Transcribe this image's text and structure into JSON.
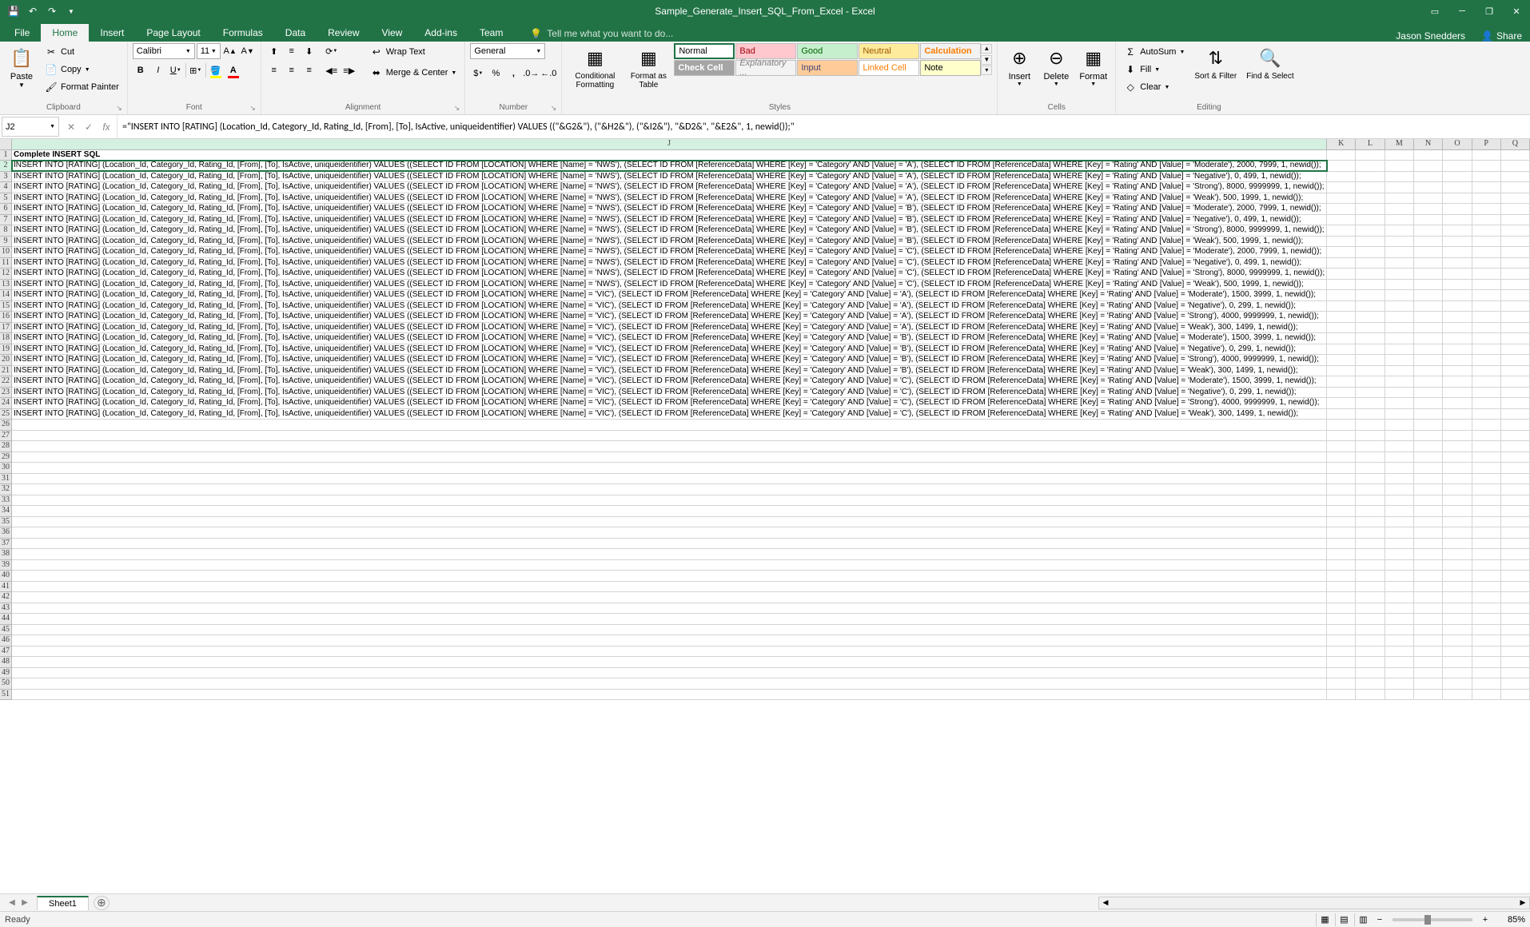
{
  "titlebar": {
    "title": "Sample_Generate_Insert_SQL_From_Excel - Excel"
  },
  "ribbon": {
    "tabs": [
      "File",
      "Home",
      "Insert",
      "Page Layout",
      "Formulas",
      "Data",
      "Review",
      "View",
      "Add-ins",
      "Team"
    ],
    "active_tab": "Home",
    "tellme_placeholder": "Tell me what you want to do...",
    "user": "Jason Snedders",
    "share": "Share"
  },
  "clipboard": {
    "paste": "Paste",
    "cut": "Cut",
    "copy": "Copy",
    "format_painter": "Format Painter",
    "group_label": "Clipboard"
  },
  "font": {
    "name": "Calibri",
    "size": "11",
    "group_label": "Font"
  },
  "alignment": {
    "wrap": "Wrap Text",
    "merge": "Merge & Center",
    "group_label": "Alignment"
  },
  "number": {
    "format": "General",
    "group_label": "Number"
  },
  "styles_group": {
    "conditional": "Conditional Formatting",
    "format_table": "Format as Table",
    "cells": {
      "normal": "Normal",
      "bad": "Bad",
      "good": "Good",
      "neutral": "Neutral",
      "calculation": "Calculation",
      "check": "Check Cell",
      "explanatory": "Explanatory ...",
      "input": "Input",
      "linked": "Linked Cell",
      "note": "Note"
    },
    "group_label": "Styles"
  },
  "cells_group": {
    "insert": "Insert",
    "delete": "Delete",
    "format": "Format",
    "group_label": "Cells"
  },
  "editing": {
    "autosum": "AutoSum",
    "fill": "Fill",
    "clear": "Clear",
    "sort": "Sort & Filter",
    "find": "Find & Select",
    "group_label": "Editing"
  },
  "formula_bar": {
    "cell_ref": "J2",
    "formula": "=\"INSERT INTO [RATING] (Location_Id, Category_Id, Rating_Id, [From], [To], IsActive, uniqueidentifier) VALUES ((\"&G2&\"), (\"&H2&\"), (\"&I2&\"), \"&D2&\", \"&E2&\", 1, newid());\""
  },
  "grid": {
    "columns": [
      "J",
      "K",
      "L",
      "M",
      "N",
      "O",
      "P",
      "Q"
    ],
    "header_row": "Complete INSERT SQL",
    "rows": [
      "INSERT INTO [RATING] (Location_Id, Category_Id, Rating_Id, [From], [To], IsActive, uniqueidentifier) VALUES ((SELECT ID FROM [LOCATION] WHERE [Name] = 'NWS'), (SELECT ID FROM [ReferenceData] WHERE [Key] = 'Category' AND [Value] = 'A'), (SELECT ID FROM [ReferenceData] WHERE [Key] = 'Rating' AND [Value] = 'Moderate'), 2000, 7999, 1, newid());",
      "INSERT INTO [RATING] (Location_Id, Category_Id, Rating_Id, [From], [To], IsActive, uniqueidentifier) VALUES ((SELECT ID FROM [LOCATION] WHERE [Name] = 'NWS'), (SELECT ID FROM [ReferenceData] WHERE [Key] = 'Category' AND [Value] = 'A'), (SELECT ID FROM [ReferenceData] WHERE [Key] = 'Rating' AND [Value] = 'Negative'), 0, 499, 1, newid());",
      "INSERT INTO [RATING] (Location_Id, Category_Id, Rating_Id, [From], [To], IsActive, uniqueidentifier) VALUES ((SELECT ID FROM [LOCATION] WHERE [Name] = 'NWS'), (SELECT ID FROM [ReferenceData] WHERE [Key] = 'Category' AND [Value] = 'A'), (SELECT ID FROM [ReferenceData] WHERE [Key] = 'Rating' AND [Value] = 'Strong'), 8000, 9999999, 1, newid());",
      "INSERT INTO [RATING] (Location_Id, Category_Id, Rating_Id, [From], [To], IsActive, uniqueidentifier) VALUES ((SELECT ID FROM [LOCATION] WHERE [Name] = 'NWS'), (SELECT ID FROM [ReferenceData] WHERE [Key] = 'Category' AND [Value] = 'A'), (SELECT ID FROM [ReferenceData] WHERE [Key] = 'Rating' AND [Value] = 'Weak'), 500, 1999, 1, newid());",
      "INSERT INTO [RATING] (Location_Id, Category_Id, Rating_Id, [From], [To], IsActive, uniqueidentifier) VALUES ((SELECT ID FROM [LOCATION] WHERE [Name] = 'NWS'), (SELECT ID FROM [ReferenceData] WHERE [Key] = 'Category' AND [Value] = 'B'), (SELECT ID FROM [ReferenceData] WHERE [Key] = 'Rating' AND [Value] = 'Moderate'), 2000, 7999, 1, newid());",
      "INSERT INTO [RATING] (Location_Id, Category_Id, Rating_Id, [From], [To], IsActive, uniqueidentifier) VALUES ((SELECT ID FROM [LOCATION] WHERE [Name] = 'NWS'), (SELECT ID FROM [ReferenceData] WHERE [Key] = 'Category' AND [Value] = 'B'), (SELECT ID FROM [ReferenceData] WHERE [Key] = 'Rating' AND [Value] = 'Negative'), 0, 499, 1, newid());",
      "INSERT INTO [RATING] (Location_Id, Category_Id, Rating_Id, [From], [To], IsActive, uniqueidentifier) VALUES ((SELECT ID FROM [LOCATION] WHERE [Name] = 'NWS'), (SELECT ID FROM [ReferenceData] WHERE [Key] = 'Category' AND [Value] = 'B'), (SELECT ID FROM [ReferenceData] WHERE [Key] = 'Rating' AND [Value] = 'Strong'), 8000, 9999999, 1, newid());",
      "INSERT INTO [RATING] (Location_Id, Category_Id, Rating_Id, [From], [To], IsActive, uniqueidentifier) VALUES ((SELECT ID FROM [LOCATION] WHERE [Name] = 'NWS'), (SELECT ID FROM [ReferenceData] WHERE [Key] = 'Category' AND [Value] = 'B'), (SELECT ID FROM [ReferenceData] WHERE [Key] = 'Rating' AND [Value] = 'Weak'), 500, 1999, 1, newid());",
      "INSERT INTO [RATING] (Location_Id, Category_Id, Rating_Id, [From], [To], IsActive, uniqueidentifier) VALUES ((SELECT ID FROM [LOCATION] WHERE [Name] = 'NWS'), (SELECT ID FROM [ReferenceData] WHERE [Key] = 'Category' AND [Value] = 'C'), (SELECT ID FROM [ReferenceData] WHERE [Key] = 'Rating' AND [Value] = 'Moderate'), 2000, 7999, 1, newid());",
      "INSERT INTO [RATING] (Location_Id, Category_Id, Rating_Id, [From], [To], IsActive, uniqueidentifier) VALUES ((SELECT ID FROM [LOCATION] WHERE [Name] = 'NWS'), (SELECT ID FROM [ReferenceData] WHERE [Key] = 'Category' AND [Value] = 'C'), (SELECT ID FROM [ReferenceData] WHERE [Key] = 'Rating' AND [Value] = 'Negative'), 0, 499, 1, newid());",
      "INSERT INTO [RATING] (Location_Id, Category_Id, Rating_Id, [From], [To], IsActive, uniqueidentifier) VALUES ((SELECT ID FROM [LOCATION] WHERE [Name] = 'NWS'), (SELECT ID FROM [ReferenceData] WHERE [Key] = 'Category' AND [Value] = 'C'), (SELECT ID FROM [ReferenceData] WHERE [Key] = 'Rating' AND [Value] = 'Strong'), 8000, 9999999, 1, newid());",
      "INSERT INTO [RATING] (Location_Id, Category_Id, Rating_Id, [From], [To], IsActive, uniqueidentifier) VALUES ((SELECT ID FROM [LOCATION] WHERE [Name] = 'NWS'), (SELECT ID FROM [ReferenceData] WHERE [Key] = 'Category' AND [Value] = 'C'), (SELECT ID FROM [ReferenceData] WHERE [Key] = 'Rating' AND [Value] = 'Weak'), 500, 1999, 1, newid());",
      "INSERT INTO [RATING] (Location_Id, Category_Id, Rating_Id, [From], [To], IsActive, uniqueidentifier) VALUES ((SELECT ID FROM [LOCATION] WHERE [Name] = 'VIC'), (SELECT ID FROM [ReferenceData] WHERE [Key] = 'Category' AND [Value] = 'A'), (SELECT ID FROM [ReferenceData] WHERE [Key] = 'Rating' AND [Value] = 'Moderate'), 1500, 3999, 1, newid());",
      "INSERT INTO [RATING] (Location_Id, Category_Id, Rating_Id, [From], [To], IsActive, uniqueidentifier) VALUES ((SELECT ID FROM [LOCATION] WHERE [Name] = 'VIC'), (SELECT ID FROM [ReferenceData] WHERE [Key] = 'Category' AND [Value] = 'A'), (SELECT ID FROM [ReferenceData] WHERE [Key] = 'Rating' AND [Value] = 'Negative'), 0, 299, 1, newid());",
      "INSERT INTO [RATING] (Location_Id, Category_Id, Rating_Id, [From], [To], IsActive, uniqueidentifier) VALUES ((SELECT ID FROM [LOCATION] WHERE [Name] = 'VIC'), (SELECT ID FROM [ReferenceData] WHERE [Key] = 'Category' AND [Value] = 'A'), (SELECT ID FROM [ReferenceData] WHERE [Key] = 'Rating' AND [Value] = 'Strong'), 4000, 9999999, 1, newid());",
      "INSERT INTO [RATING] (Location_Id, Category_Id, Rating_Id, [From], [To], IsActive, uniqueidentifier) VALUES ((SELECT ID FROM [LOCATION] WHERE [Name] = 'VIC'), (SELECT ID FROM [ReferenceData] WHERE [Key] = 'Category' AND [Value] = 'A'), (SELECT ID FROM [ReferenceData] WHERE [Key] = 'Rating' AND [Value] = 'Weak'), 300, 1499, 1, newid());",
      "INSERT INTO [RATING] (Location_Id, Category_Id, Rating_Id, [From], [To], IsActive, uniqueidentifier) VALUES ((SELECT ID FROM [LOCATION] WHERE [Name] = 'VIC'), (SELECT ID FROM [ReferenceData] WHERE [Key] = 'Category' AND [Value] = 'B'), (SELECT ID FROM [ReferenceData] WHERE [Key] = 'Rating' AND [Value] = 'Moderate'), 1500, 3999, 1, newid());",
      "INSERT INTO [RATING] (Location_Id, Category_Id, Rating_Id, [From], [To], IsActive, uniqueidentifier) VALUES ((SELECT ID FROM [LOCATION] WHERE [Name] = 'VIC'), (SELECT ID FROM [ReferenceData] WHERE [Key] = 'Category' AND [Value] = 'B'), (SELECT ID FROM [ReferenceData] WHERE [Key] = 'Rating' AND [Value] = 'Negative'), 0, 299, 1, newid());",
      "INSERT INTO [RATING] (Location_Id, Category_Id, Rating_Id, [From], [To], IsActive, uniqueidentifier) VALUES ((SELECT ID FROM [LOCATION] WHERE [Name] = 'VIC'), (SELECT ID FROM [ReferenceData] WHERE [Key] = 'Category' AND [Value] = 'B'), (SELECT ID FROM [ReferenceData] WHERE [Key] = 'Rating' AND [Value] = 'Strong'), 4000, 9999999, 1, newid());",
      "INSERT INTO [RATING] (Location_Id, Category_Id, Rating_Id, [From], [To], IsActive, uniqueidentifier) VALUES ((SELECT ID FROM [LOCATION] WHERE [Name] = 'VIC'), (SELECT ID FROM [ReferenceData] WHERE [Key] = 'Category' AND [Value] = 'B'), (SELECT ID FROM [ReferenceData] WHERE [Key] = 'Rating' AND [Value] = 'Weak'), 300, 1499, 1, newid());",
      "INSERT INTO [RATING] (Location_Id, Category_Id, Rating_Id, [From], [To], IsActive, uniqueidentifier) VALUES ((SELECT ID FROM [LOCATION] WHERE [Name] = 'VIC'), (SELECT ID FROM [ReferenceData] WHERE [Key] = 'Category' AND [Value] = 'C'), (SELECT ID FROM [ReferenceData] WHERE [Key] = 'Rating' AND [Value] = 'Moderate'), 1500, 3999, 1, newid());",
      "INSERT INTO [RATING] (Location_Id, Category_Id, Rating_Id, [From], [To], IsActive, uniqueidentifier) VALUES ((SELECT ID FROM [LOCATION] WHERE [Name] = 'VIC'), (SELECT ID FROM [ReferenceData] WHERE [Key] = 'Category' AND [Value] = 'C'), (SELECT ID FROM [ReferenceData] WHERE [Key] = 'Rating' AND [Value] = 'Negative'), 0, 299, 1, newid());",
      "INSERT INTO [RATING] (Location_Id, Category_Id, Rating_Id, [From], [To], IsActive, uniqueidentifier) VALUES ((SELECT ID FROM [LOCATION] WHERE [Name] = 'VIC'), (SELECT ID FROM [ReferenceData] WHERE [Key] = 'Category' AND [Value] = 'C'), (SELECT ID FROM [ReferenceData] WHERE [Key] = 'Rating' AND [Value] = 'Strong'), 4000, 9999999, 1, newid());",
      "INSERT INTO [RATING] (Location_Id, Category_Id, Rating_Id, [From], [To], IsActive, uniqueidentifier) VALUES ((SELECT ID FROM [LOCATION] WHERE [Name] = 'VIC'), (SELECT ID FROM [ReferenceData] WHERE [Key] = 'Category' AND [Value] = 'C'), (SELECT ID FROM [ReferenceData] WHERE [Key] = 'Rating' AND [Value] = 'Weak'), 300, 1499, 1, newid());"
    ],
    "empty_row_count": 26,
    "last_row_num": 51
  },
  "sheets": {
    "active": "Sheet1"
  },
  "status": {
    "state": "Ready",
    "zoom": "85%"
  }
}
